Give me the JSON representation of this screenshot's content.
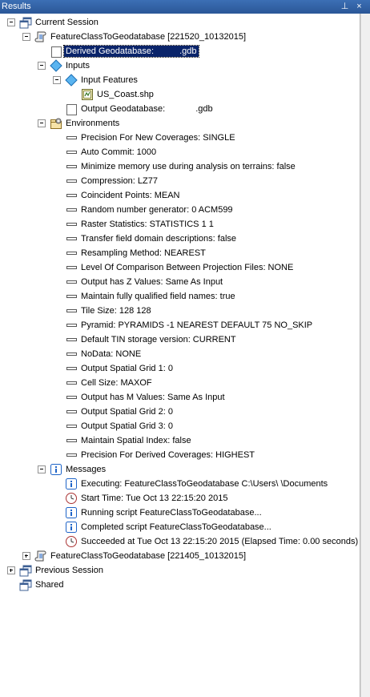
{
  "window": {
    "title": "Results",
    "pin_glyph": "⊥",
    "close_glyph": "×"
  },
  "tree": {
    "current_session": "Current Session",
    "tool1": "FeatureClassToGeodatabase [221520_10132015]",
    "derived_geodatabase": "Derived Geodatabase:",
    "derived_geodatabase_ext": ".gdb",
    "inputs": "Inputs",
    "input_features": "Input Features",
    "us_coast": "US_Coast.shp",
    "output_geodatabase": "Output Geodatabase:",
    "output_geodatabase_ext": ".gdb",
    "environments_label": "Environments",
    "environments": [
      "Precision For New Coverages: SINGLE",
      "Auto Commit: 1000",
      "Minimize memory use during analysis on terrains: false",
      "Compression: LZ77",
      "Coincident Points: MEAN",
      "Random number generator: 0 ACM599",
      "Raster Statistics: STATISTICS 1 1",
      "Transfer field domain descriptions: false",
      "Resampling Method: NEAREST",
      "Level Of Comparison Between Projection Files: NONE",
      "Output has Z Values: Same As Input",
      "Maintain fully qualified field names: true",
      "Tile Size: 128 128",
      "Pyramid: PYRAMIDS -1 NEAREST DEFAULT 75 NO_SKIP",
      "Default TIN storage version: CURRENT",
      "NoData: NONE",
      "Output Spatial Grid 1: 0",
      "Cell Size: MAXOF",
      "Output has M Values: Same As Input",
      "Output Spatial Grid 2: 0",
      "Output Spatial Grid 3: 0",
      "Maintain Spatial Index: false",
      "Precision For Derived Coverages: HIGHEST"
    ],
    "messages_label": "Messages",
    "messages": [
      {
        "icon": "info-icon",
        "text": "Executing: FeatureClassToGeodatabase C:\\Users\\          \\Documents"
      },
      {
        "icon": "clock-icon",
        "text": "Start Time: Tue Oct 13 22:15:20 2015"
      },
      {
        "icon": "info-icon",
        "text": "Running script FeatureClassToGeodatabase..."
      },
      {
        "icon": "info-icon",
        "text": "Completed script FeatureClassToGeodatabase..."
      },
      {
        "icon": "clock-icon",
        "text": "Succeeded at Tue Oct 13 22:15:20 2015 (Elapsed Time: 0.00 seconds)"
      }
    ],
    "tool2": "FeatureClassToGeodatabase [221405_10132015]",
    "previous_session": "Previous Session",
    "shared": "Shared"
  },
  "colors": {
    "titlebar": "#2b5797",
    "selection": "#0a246a",
    "diamond": "#3a9be0",
    "info_blue": "#1e64c8"
  }
}
